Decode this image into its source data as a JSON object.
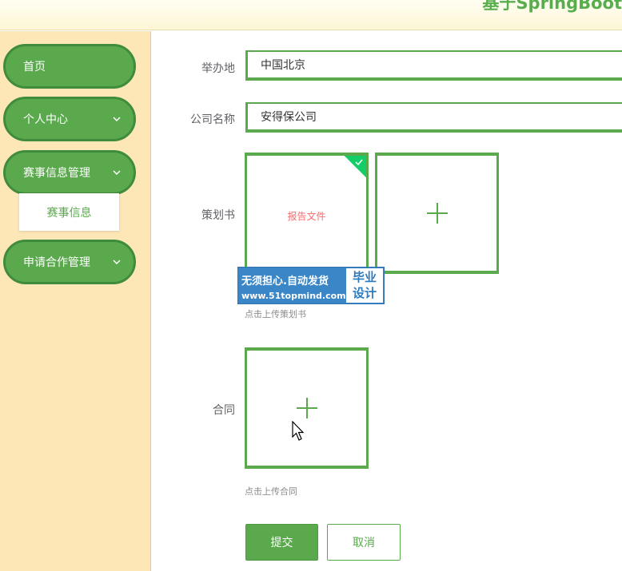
{
  "header": {
    "brand_text": "基于SpringBoot"
  },
  "sidebar": {
    "items": [
      {
        "label": "首页"
      },
      {
        "label": "个人中心"
      },
      {
        "label": "赛事信息管理"
      },
      {
        "label": "申请合作管理"
      }
    ],
    "submenu": [
      {
        "label": "赛事信息"
      }
    ]
  },
  "form": {
    "venue": {
      "label": "举办地",
      "value": "中国北京"
    },
    "company": {
      "label": "公司名称",
      "value": "安得保公司"
    },
    "proposal": {
      "label": "策划书",
      "file_text": "报告文件",
      "tip": "点击上传策划书"
    },
    "contract": {
      "label": "合同",
      "tip": "点击上传合同"
    },
    "submit_label": "提交",
    "cancel_label": "取消"
  },
  "watermark": {
    "line1": "无须担心.自动发货",
    "line2": "www.51topmind.com",
    "badge_line1": "毕业",
    "badge_line2": "设计"
  },
  "colors": {
    "primary": "#5aa94c",
    "sidebar_bg": "#fde7b7",
    "watermark_bg": "#3a86c6",
    "file_text": "#f56c6c"
  }
}
